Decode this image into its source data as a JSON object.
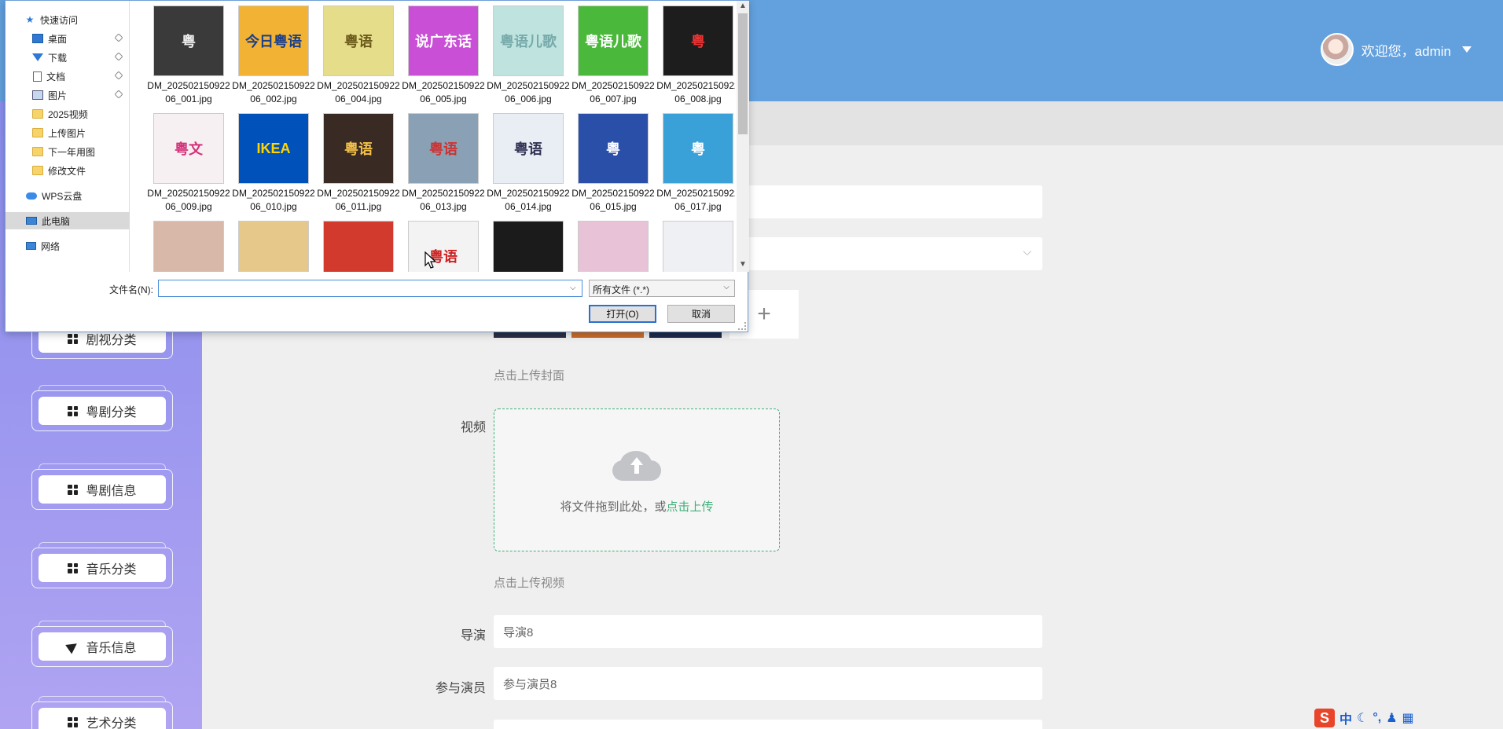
{
  "header": {
    "welcome": "欢迎您，admin"
  },
  "sidebar": {
    "items": [
      {
        "label": "剧视分类",
        "icon": "grid-icon"
      },
      {
        "label": "粤剧分类",
        "icon": "grid-icon"
      },
      {
        "label": "粤剧信息",
        "icon": "grid-icon"
      },
      {
        "label": "音乐分类",
        "icon": "grid-icon"
      },
      {
        "label": "音乐信息",
        "icon": "send-icon"
      },
      {
        "label": "艺术分类",
        "icon": "grid-icon"
      }
    ]
  },
  "form": {
    "cover_hint": "点击上传封面",
    "video_label": "视频",
    "drop_text": "将文件拖到此处，或",
    "drop_link": "点击上传",
    "video_hint": "点击上传视频",
    "director_label": "导演",
    "director_value": "导演8",
    "cast_label": "参与演员",
    "cast_value": "参与演员8"
  },
  "dialog": {
    "nav": [
      {
        "label": "快速访问",
        "icon": "star-icon"
      },
      {
        "label": "桌面",
        "icon": "desktop-icon",
        "pinned": true
      },
      {
        "label": "下载",
        "icon": "download-icon",
        "pinned": true
      },
      {
        "label": "文档",
        "icon": "document-icon",
        "pinned": true
      },
      {
        "label": "图片",
        "icon": "picture-icon",
        "pinned": true
      },
      {
        "label": "2025视频",
        "icon": "folder-icon"
      },
      {
        "label": "上传图片",
        "icon": "folder-icon"
      },
      {
        "label": "下一年用图",
        "icon": "folder-icon"
      },
      {
        "label": "修改文件",
        "icon": "folder-icon"
      },
      {
        "label": "WPS云盘",
        "icon": "cloud-icon"
      },
      {
        "label": "此电脑",
        "icon": "computer-icon",
        "selected": true
      },
      {
        "label": "网络",
        "icon": "network-icon"
      }
    ],
    "files": [
      {
        "name": "DM_20250215092206_001.jpg",
        "thumb_text": "粤",
        "bg": "#3a3a3a",
        "fg": "#eee"
      },
      {
        "name": "DM_20250215092206_002.jpg",
        "thumb_text": "今日粤语",
        "bg": "#f2b233",
        "fg": "#1b3f8a"
      },
      {
        "name": "DM_20250215092206_004.jpg",
        "thumb_text": "粤语",
        "bg": "#e6dd8a",
        "fg": "#6a5a1a"
      },
      {
        "name": "DM_20250215092206_005.jpg",
        "thumb_text": "说广东话",
        "bg": "#c84fd6",
        "fg": "#fff"
      },
      {
        "name": "DM_20250215092206_006.jpg",
        "thumb_text": "粤语儿歌",
        "bg": "#bfe3df",
        "fg": "#7aa"
      },
      {
        "name": "DM_20250215092206_007.jpg",
        "thumb_text": "粤语儿歌",
        "bg": "#4ab83a",
        "fg": "#fff"
      },
      {
        "name": "DM_20250215092206_008.jpg",
        "thumb_text": "粤",
        "bg": "#1d1d1d",
        "fg": "#e33"
      },
      {
        "name": "DM_20250215092206_009.jpg",
        "thumb_text": "粤文",
        "bg": "#f7f0f2",
        "fg": "#d3337a"
      },
      {
        "name": "DM_20250215092206_010.jpg",
        "thumb_text": "IKEA",
        "bg": "#0051ba",
        "fg": "#ffd500"
      },
      {
        "name": "DM_20250215092206_011.jpg",
        "thumb_text": "粤语",
        "bg": "#3a2a24",
        "fg": "#f2c14a"
      },
      {
        "name": "DM_20250215092206_013.jpg",
        "thumb_text": "粤语",
        "bg": "#8aa0b4",
        "fg": "#c33"
      },
      {
        "name": "DM_20250215092206_014.jpg",
        "thumb_text": "粤语",
        "bg": "#e8eef4",
        "fg": "#335"
      },
      {
        "name": "DM_20250215092206_015.jpg",
        "thumb_text": "粤",
        "bg": "#2a4fa8",
        "fg": "#fff"
      },
      {
        "name": "DM_20250215092206_017.jpg",
        "thumb_text": "粤",
        "bg": "#3aa0d8",
        "fg": "#fff"
      },
      {
        "name": "",
        "thumb_text": "",
        "bg": "#d8b8a8",
        "fg": "#fff"
      },
      {
        "name": "",
        "thumb_text": "",
        "bg": "#e6c98a",
        "fg": "#a22"
      },
      {
        "name": "",
        "thumb_text": "",
        "bg": "#d23a2e",
        "fg": "#fff"
      },
      {
        "name": "",
        "thumb_text": "粤语",
        "bg": "#f3f3f3",
        "fg": "#c22"
      },
      {
        "name": "",
        "thumb_text": "",
        "bg": "#1b1b1b",
        "fg": "#fff"
      },
      {
        "name": "",
        "thumb_text": "",
        "bg": "#e8c2d6",
        "fg": "#a26"
      },
      {
        "name": "",
        "thumb_text": "",
        "bg": "#eef0f4",
        "fg": "#336"
      }
    ],
    "filename_label": "文件名(N):",
    "filename_value": "",
    "filter_value": "所有文件 (*.*)",
    "open_label": "打开(O)",
    "cancel_label": "取消"
  },
  "ime": {
    "logo": "S",
    "mode": "中"
  },
  "colors": {
    "header_bg": "#62a0de",
    "accent_green": "#40b07a",
    "sidebar_top": "#8b8ff0",
    "sidebar_bottom": "#b0a4f2"
  }
}
